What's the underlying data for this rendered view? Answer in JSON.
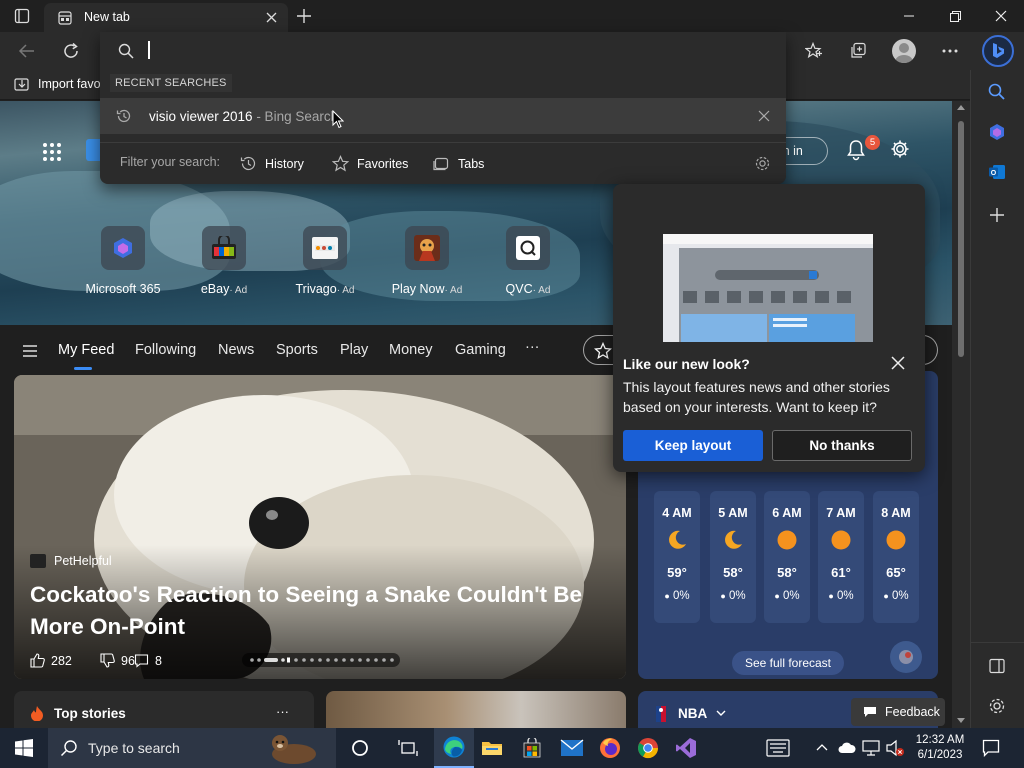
{
  "browser": {
    "tab_title": "New tab",
    "address_value": "",
    "favorites_bar": {
      "import_label": "Import favo"
    }
  },
  "omnibox": {
    "section_label": "RECENT SEARCHES",
    "recent": {
      "query": "visio viewer 2016",
      "suffix": " - Bing Search"
    },
    "filter_label": "Filter your search:",
    "filters": [
      "History",
      "Favorites",
      "Tabs"
    ]
  },
  "newtab": {
    "sign_in": "ign in",
    "notification_count": "5",
    "quick_links": [
      {
        "label": "Microsoft 365",
        "ad": ""
      },
      {
        "label": "eBay",
        "ad": "· Ad"
      },
      {
        "label": "Trivago",
        "ad": "· Ad"
      },
      {
        "label": "Play Now",
        "ad": "· Ad"
      },
      {
        "label": "QVC",
        "ad": "· Ad"
      }
    ],
    "nav": [
      "My Feed",
      "Following",
      "News",
      "Sports",
      "Play",
      "Money",
      "Gaming",
      "···"
    ],
    "feature": {
      "source": "PetHelpful",
      "headline": "Cockatoo's Reaction to Seeing a Snake Couldn't Be More On-Point",
      "likes": "282",
      "dislikes": "96",
      "comments": "8"
    },
    "weather": {
      "hours": [
        {
          "time": "4 AM",
          "temp": "59°",
          "rain": "0%",
          "icon": "moon-icon"
        },
        {
          "time": "5 AM",
          "temp": "58°",
          "rain": "0%",
          "icon": "moon-icon"
        },
        {
          "time": "6 AM",
          "temp": "58°",
          "rain": "0%",
          "icon": "sun-icon"
        },
        {
          "time": "7 AM",
          "temp": "61°",
          "rain": "0%",
          "icon": "sun-icon"
        },
        {
          "time": "8 AM",
          "temp": "65°",
          "rain": "0%",
          "icon": "sun-icon"
        }
      ],
      "forecast_button": "See full forecast"
    },
    "bottom": {
      "top_stories": "Top stories",
      "nba": "NBA",
      "feedback": "Feedback",
      "more": "···"
    }
  },
  "popup": {
    "title": "Like our new look?",
    "body": "This layout features news and other stories based on your interests. Want to keep it?",
    "keep_label": "Keep layout",
    "decline_label": "No thanks"
  },
  "taskbar": {
    "search_placeholder": "Type to search",
    "time": "12:32 AM",
    "date": "6/1/2023"
  },
  "colors": {
    "accent": "#1a5fd6",
    "edge_blue": "#0078d4",
    "badge": "#e8563c"
  }
}
